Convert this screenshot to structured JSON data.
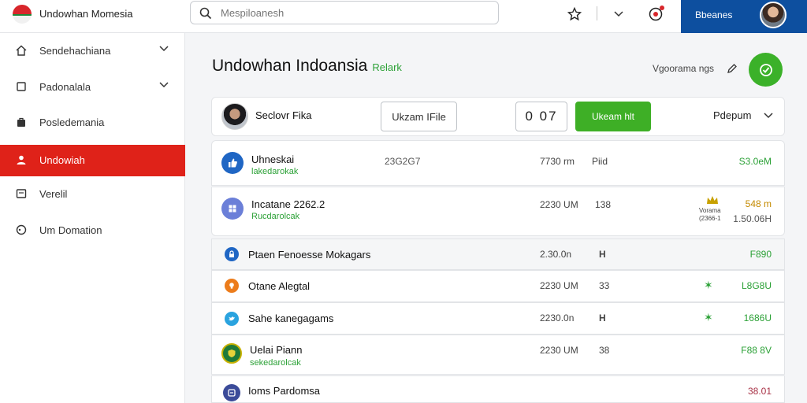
{
  "header": {
    "app_title": "Undowhan Momesia",
    "search_placeholder": "Mespiloanesh",
    "account_name": "Bbeanes",
    "icons": [
      "search-icon",
      "bookmark-icon",
      "chevron-down-icon",
      "notification-icon"
    ]
  },
  "sidebar": {
    "items": [
      {
        "label": "Sendehachiana",
        "icon": "home-icon",
        "has_chevron": true,
        "active": false
      },
      {
        "label": "Padonalala",
        "icon": "box-icon",
        "has_chevron": true,
        "active": false
      },
      {
        "label": "Posledemania",
        "icon": "bag-icon",
        "has_chevron": false,
        "active": false
      },
      {
        "label": "Undowiah",
        "icon": "user-icon",
        "has_chevron": false,
        "active": true
      },
      {
        "label": "Verelil",
        "icon": "window-icon",
        "has_chevron": false,
        "active": false
      },
      {
        "label": "Um Domation",
        "icon": "circle-icon",
        "has_chevron": false,
        "active": false
      }
    ],
    "accent_color": "#df2219"
  },
  "main": {
    "title": "Undowhan Indoansia",
    "title_sub": "Relark",
    "top_right_label": "Vgoorama ngs",
    "profile": {
      "name": "Seclovr Fika",
      "outline_button": "Ukzam IFile",
      "counter_value": "0 07",
      "green_button": "Ukeam hlt",
      "dropdown_label": "Pdepum"
    },
    "rows": [
      {
        "name": "Uhneskai",
        "sub": "lakedarokak",
        "c1": "23G2G7",
        "c2": "7730 rm",
        "c3": "Piid",
        "amount": "S3.0eM",
        "amount_color": "green",
        "icon": "thumbs-up-icon",
        "icon_color": "#1f66c4"
      },
      {
        "name": "Incatane 2262.2",
        "sub": "Rucdarolcak",
        "c1": "",
        "c2": "2230 UM",
        "c3": "138",
        "amount": "548 m",
        "amount2": "1.50.06H",
        "badge": "Vorama (2366-1",
        "amount_color": "gold",
        "icon": "puzzle-icon",
        "icon_color": "#6b7fd8"
      },
      {
        "name": "Ptaen Fenoesse Mokagars",
        "sub": "",
        "c1": "",
        "c2": "2.30.0n",
        "c3": "H",
        "amount": "F890",
        "amount_color": "green",
        "icon": "lock-icon",
        "icon_color": "#1f66c4"
      },
      {
        "name": "Otane Alegtal",
        "sub": "",
        "c1": "",
        "c2": "2230 UM",
        "c3": "33",
        "amount": "L8G8U",
        "star": true,
        "amount_color": "green",
        "icon": "bulb-icon",
        "icon_color": "#ec7c1b"
      },
      {
        "name": "Sahe kanegagams",
        "sub": "",
        "c1": "",
        "c2": "2230.0n",
        "c3": "H",
        "amount": "1686U",
        "star": true,
        "amount_color": "green",
        "icon": "bird-icon",
        "icon_color": "#2aa3df"
      },
      {
        "name": "Uelai Piann",
        "sub": "sekedarolcak",
        "c1": "",
        "c2": "2230 UM",
        "c3": "38",
        "amount": "F88 8V",
        "amount_color": "green",
        "icon": "shield-icon",
        "icon_color": "#1f7a3a"
      },
      {
        "name": "Ioms Pardomsa",
        "sub": "",
        "c1": "",
        "c2": "",
        "c3": "",
        "amount": "38.01",
        "amount_color": "dark-red",
        "icon": "grid-icon",
        "icon_color": "#3b4b99"
      }
    ]
  }
}
